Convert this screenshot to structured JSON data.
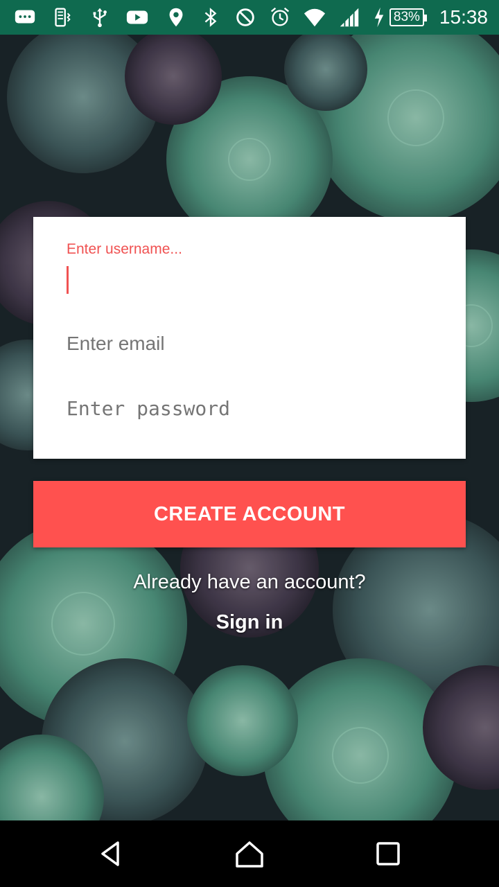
{
  "status_bar": {
    "battery_percent": "83%",
    "time": "15:38",
    "left_icons": [
      "message-icon",
      "vibrate-icon",
      "usb-icon",
      "youtube-icon"
    ],
    "right_icons": [
      "location-icon",
      "bluetooth-icon",
      "do-not-disturb-icon",
      "alarm-icon",
      "wifi-icon",
      "signal-icon",
      "charging-icon"
    ],
    "color": "#0f6a4f"
  },
  "form": {
    "username_label": "Enter username...",
    "username_value": "",
    "email_placeholder": "Enter email",
    "password_placeholder": "Enter password"
  },
  "actions": {
    "create_account_label": "CREATE ACCOUNT",
    "have_account_text": "Already have an account?",
    "sign_in_label": "Sign in"
  },
  "colors": {
    "accent": "#ff514f",
    "label_accent": "#f05252"
  },
  "nav_bar": {
    "icons": [
      "back-icon",
      "home-icon",
      "recent-apps-icon"
    ]
  }
}
